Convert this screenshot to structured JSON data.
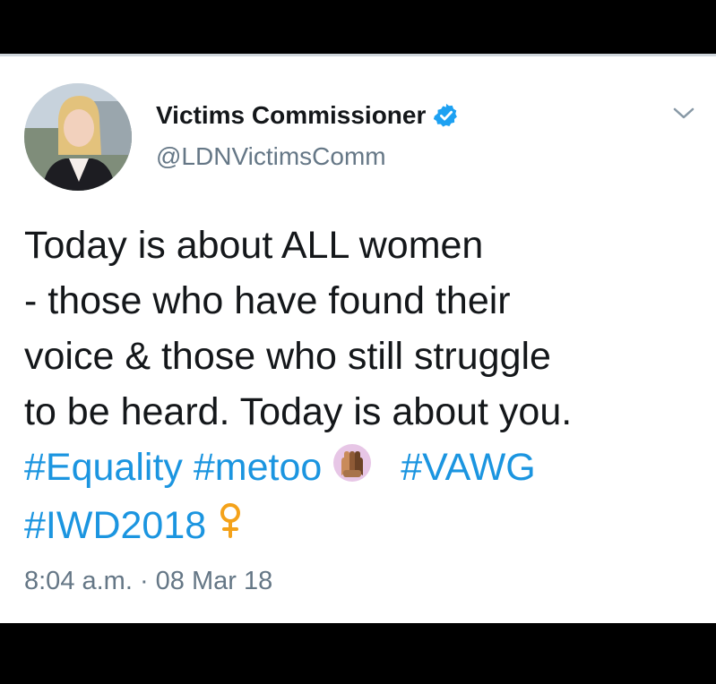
{
  "tweet": {
    "author": {
      "name": "Victims Commissioner",
      "handle": "@LDNVictimsComm",
      "verified": true
    },
    "text_lines": [
      "Today is about ALL women",
      "- those who have found their",
      "voice & those who still struggle",
      "to be heard. Today is about you."
    ],
    "hashtags": [
      "#Equality",
      "#metoo",
      "#VAWG",
      "#IWD2018"
    ],
    "emojis": [
      "raised-hands-icon",
      "female-sign-icon"
    ],
    "timestamp": "8:04 a.m. · 08 Mar 18"
  },
  "colors": {
    "hashtag": "#1b95e0",
    "text": "#14171a",
    "secondary": "#657786",
    "verified": "#1da1f2",
    "female_sign": "#f4a21a",
    "background_bar": "#000000"
  }
}
